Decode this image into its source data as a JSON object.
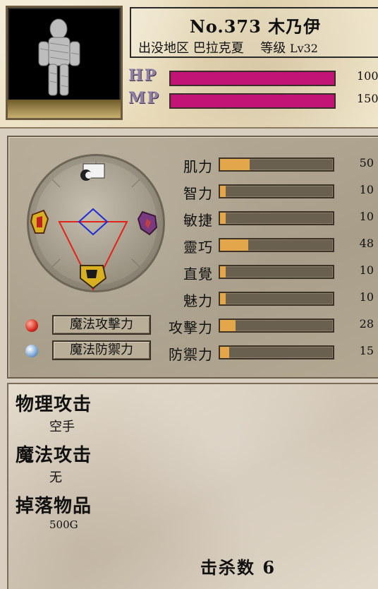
{
  "monster": {
    "number_label": "No.373",
    "name": "木乃伊",
    "area_label": "出没地区",
    "area": "巴拉克夏",
    "level_label": "等级",
    "level": "Lv32"
  },
  "vitals": {
    "hp_label": "HP",
    "hp_value": "100",
    "hp_fill": 1.0,
    "mp_label": "MP",
    "mp_value": "150",
    "mp_fill": 1.0
  },
  "stats": [
    {
      "label": "肌力",
      "value": "50",
      "fill": 0.26
    },
    {
      "label": "智力",
      "value": "10",
      "fill": 0.05
    },
    {
      "label": "敏捷",
      "value": "10",
      "fill": 0.05
    },
    {
      "label": "靈巧",
      "value": "48",
      "fill": 0.25
    },
    {
      "label": "直覺",
      "value": "10",
      "fill": 0.05
    },
    {
      "label": "魅力",
      "value": "10",
      "fill": 0.05
    },
    {
      "label": "攻擊力",
      "value": "28",
      "fill": 0.14
    },
    {
      "label": "防禦力",
      "value": "15",
      "fill": 0.08
    }
  ],
  "magic": {
    "attack_button": "魔法攻擊力",
    "defense_button": "魔法防禦力",
    "attack_orb_color": "#d42a1e",
    "defense_orb_color": "#7aa6d6"
  },
  "info": {
    "physical_attack_label": "物理攻击",
    "physical_attack_value": "空手",
    "magic_attack_label": "魔法攻击",
    "magic_attack_value": "无",
    "drop_label": "掉落物品",
    "drop_value": "500G"
  },
  "kills": {
    "label": "击杀数",
    "value": "6"
  },
  "colors": {
    "hp_mp_fill": "#c21477",
    "stat_fill": "#e3a64a"
  },
  "icons": {
    "portrait": "mummy-portrait",
    "wheel_top": "moon-icon",
    "wheel_left": "fire-shield-icon",
    "wheel_right": "water-shield-icon",
    "wheel_bottom": "earth-shield-icon"
  }
}
